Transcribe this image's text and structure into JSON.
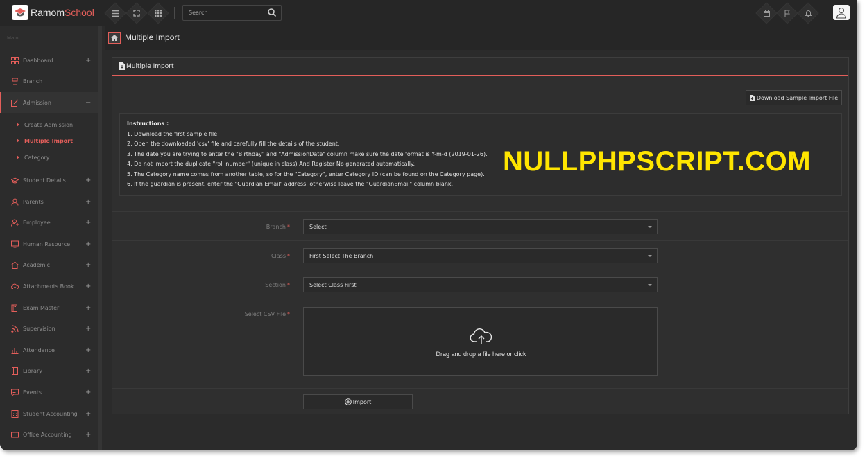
{
  "app": {
    "logo_part1": "Ramom",
    "logo_part2": "School",
    "brand_color": "#e35e5a",
    "watermark": "NULLPHPSCRIPT.COM"
  },
  "topbar": {
    "search_placeholder": "Search",
    "icons": [
      "menu-icon",
      "fullscreen-icon",
      "apps-grid-icon",
      "calendar-icon",
      "flag-icon",
      "bell-icon",
      "user-avatar-icon"
    ]
  },
  "sidebar": {
    "section_label": "Main",
    "items": [
      {
        "label": "Dashboard",
        "toggle": "+",
        "icon": "dashboard-icon"
      },
      {
        "label": "Branch",
        "toggle": "",
        "icon": "branch-icon"
      },
      {
        "label": "Admission",
        "toggle": "−",
        "icon": "edit-icon"
      },
      {
        "label": "Student Details",
        "toggle": "+",
        "icon": "graduation-cap-icon"
      },
      {
        "label": "Parents",
        "toggle": "+",
        "icon": "user-icon"
      },
      {
        "label": "Employee",
        "toggle": "+",
        "icon": "employee-icon"
      },
      {
        "label": "Human Resource",
        "toggle": "+",
        "icon": "monitor-icon"
      },
      {
        "label": "Academic",
        "toggle": "+",
        "icon": "home-icon"
      },
      {
        "label": "Attachments Book",
        "toggle": "+",
        "icon": "cloud-upload-icon"
      },
      {
        "label": "Exam Master",
        "toggle": "+",
        "icon": "book-icon"
      },
      {
        "label": "Supervision",
        "toggle": "+",
        "icon": "rss-icon"
      },
      {
        "label": "Attendance",
        "toggle": "+",
        "icon": "bar-chart-icon"
      },
      {
        "label": "Library",
        "toggle": "+",
        "icon": "library-icon"
      },
      {
        "label": "Events",
        "toggle": "+",
        "icon": "message-icon"
      },
      {
        "label": "Student Accounting",
        "toggle": "+",
        "icon": "calculator-icon"
      },
      {
        "label": "Office Accounting",
        "toggle": "+",
        "icon": "credit-card-icon"
      }
    ],
    "admission_sub": [
      "Create Admission",
      "Multiple Import",
      "Category"
    ]
  },
  "header": {
    "title": "Multiple Import"
  },
  "panel": {
    "title": "Multiple Import",
    "download_button": "Download Sample Import File",
    "instructions_title": "Instructions :",
    "instructions": [
      "1. Download the first sample file.",
      "2. Open the downloaded 'csv' file and carefully fill the details of the student.",
      "3. The date you are trying to enter the \"Birthday\" and \"AdmissionDate\" column make sure the date format is Y-m-d (2019-01-26).",
      "4. Do not import the duplicate \"roll number\" (unique in class) And Register No generated automatically.",
      "5. The Category name comes from another table, so for the \"Category\", enter Category ID (can be found on the Category page).",
      "6. If the guardian is present, enter the \"Guardian Email\" address, otherwise leave the \"GuardianEmail\" column blank."
    ],
    "fields": {
      "branch": {
        "label": "Branch",
        "value": "Select"
      },
      "class": {
        "label": "Class",
        "value": "First Select The Branch"
      },
      "section": {
        "label": "Section",
        "value": "Select Class First"
      },
      "csv": {
        "label": "Select CSV File",
        "dropzone_text": "Drag and drop a file here or click"
      }
    },
    "required_mark": "*",
    "import_button": "Import"
  }
}
